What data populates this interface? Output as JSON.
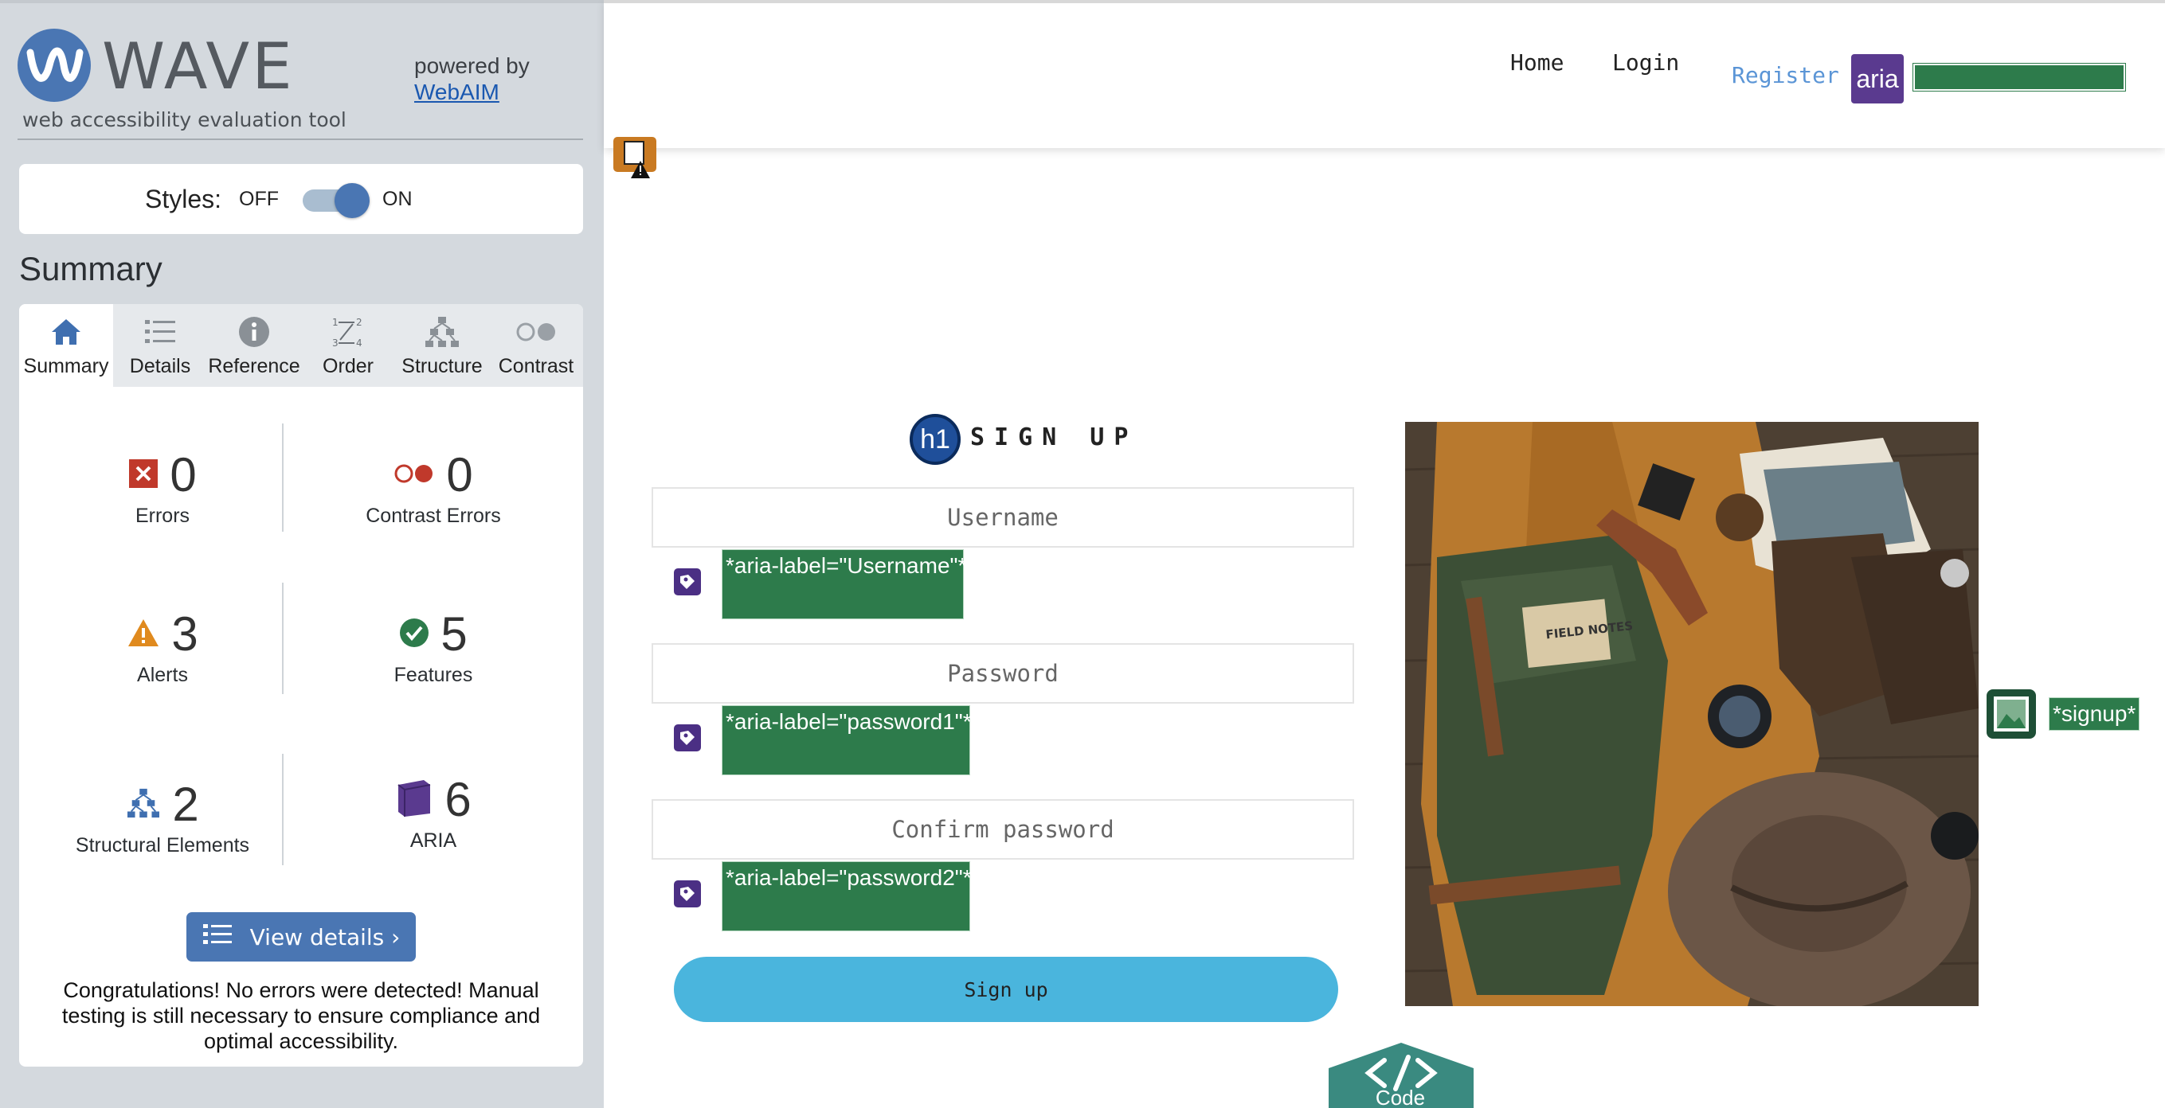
{
  "sidebar": {
    "logo_word": "WAVE",
    "tagline": "web accessibility evaluation tool",
    "powered_by": "powered by",
    "webaim_link": "WebAIM",
    "styles": {
      "label": "Styles:",
      "off": "OFF",
      "on": "ON",
      "enabled": true
    },
    "summary_heading": "Summary",
    "tabs": [
      {
        "label": "Summary",
        "icon": "home-icon",
        "active": true
      },
      {
        "label": "Details",
        "icon": "list-icon",
        "active": false
      },
      {
        "label": "Reference",
        "icon": "info-icon",
        "active": false
      },
      {
        "label": "Order",
        "icon": "order-icon",
        "active": false
      },
      {
        "label": "Structure",
        "icon": "structure-icon",
        "active": false
      },
      {
        "label": "Contrast",
        "icon": "contrast-icon",
        "active": false
      }
    ],
    "metrics": {
      "errors": {
        "count": "0",
        "label": "Errors"
      },
      "contrast_errors": {
        "count": "0",
        "label": "Contrast Errors"
      },
      "alerts": {
        "count": "3",
        "label": "Alerts"
      },
      "features": {
        "count": "5",
        "label": "Features"
      },
      "structural": {
        "count": "2",
        "label": "Structural Elements"
      },
      "aria": {
        "count": "6",
        "label": "ARIA"
      }
    },
    "view_details": "View details ›",
    "congrats": "Congratulations! No errors were detected! Manual testing is still necessary to ensure compliance and optimal accessibility."
  },
  "page": {
    "nav": {
      "home": "Home",
      "login": "Login",
      "register": "Register",
      "aria_badge": "aria"
    },
    "h1_badge": "h1",
    "title": "SIGN UP",
    "fields": [
      {
        "placeholder": "Username",
        "aria_label": "*aria-label=\"Username\"*"
      },
      {
        "placeholder": "Password",
        "aria_label": "*aria-label=\"password1\"*"
      },
      {
        "placeholder": "Confirm password",
        "aria_label": "*aria-label=\"password2\"*"
      }
    ],
    "signup_button": "Sign up",
    "image_label": "*signup*",
    "field_notes": "FIELD NOTES",
    "code_tab": "Code"
  },
  "colors": {
    "wave_blue": "#4a76b3",
    "aria_purple": "#5a3a8f",
    "feature_green": "#2d7b4b",
    "button_cyan": "#4ab5dd",
    "error_red": "#c0392b",
    "alert_orange": "#e08a1e",
    "code_teal": "#3a8a80"
  }
}
